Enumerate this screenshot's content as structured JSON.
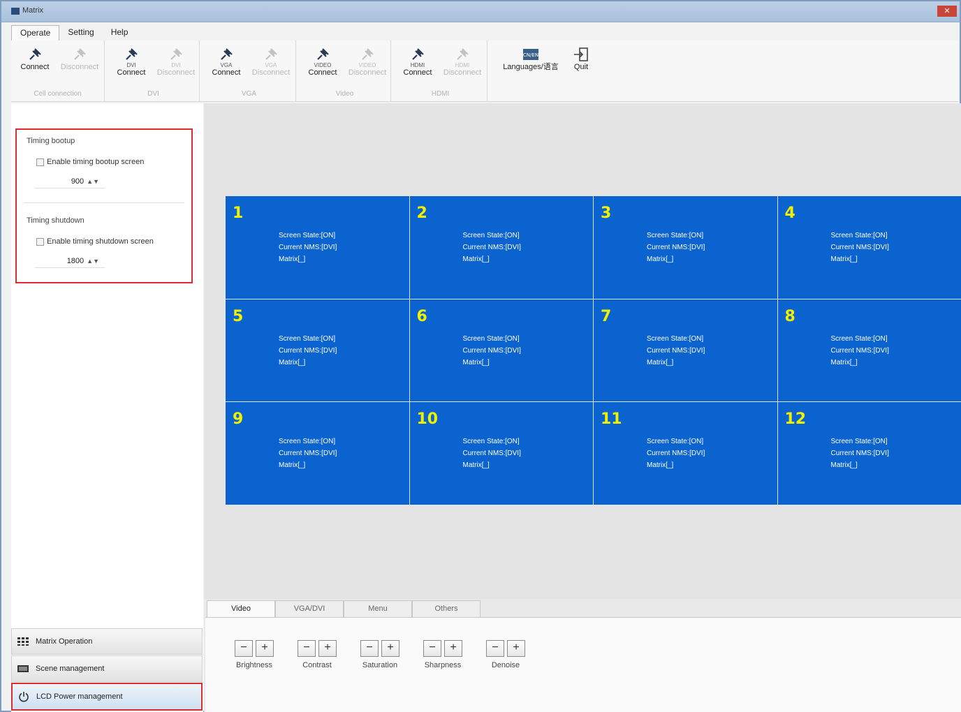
{
  "window": {
    "title": "Matrix"
  },
  "menu": [
    "Operate",
    "Setting",
    "Help"
  ],
  "ribbon": {
    "groups": [
      {
        "title": "Cell connection",
        "buttons": [
          {
            "sub": "",
            "label": "Connect",
            "enabled": true
          },
          {
            "sub": "",
            "label": "Disconnect",
            "enabled": false
          }
        ]
      },
      {
        "title": "DVI",
        "buttons": [
          {
            "sub": "DVI",
            "label": "Connect",
            "enabled": true
          },
          {
            "sub": "DVI",
            "label": "Disconnect",
            "enabled": false
          }
        ]
      },
      {
        "title": "VGA",
        "buttons": [
          {
            "sub": "VGA",
            "label": "Connect",
            "enabled": true
          },
          {
            "sub": "VGA",
            "label": "Disconnect",
            "enabled": false
          }
        ]
      },
      {
        "title": "Video",
        "buttons": [
          {
            "sub": "VIDEO",
            "label": "Connect",
            "enabled": true
          },
          {
            "sub": "VIDEO",
            "label": "Disconnect",
            "enabled": false
          }
        ]
      },
      {
        "title": "HDMI",
        "buttons": [
          {
            "sub": "HDMI",
            "label": "Connect",
            "enabled": true
          },
          {
            "sub": "HDMI",
            "label": "Disconnect",
            "enabled": false
          }
        ]
      }
    ],
    "languages_label": "Languages/语言",
    "quit_label": "Quit"
  },
  "left": {
    "bootup_title": "Timing bootup",
    "bootup_check": "Enable timing bootup screen",
    "bootup_value": "900",
    "shutdown_title": "Timing shutdown",
    "shutdown_check": "Enable timing shutdown screen",
    "shutdown_value": "1800",
    "nav": [
      "Matrix Operation",
      "Scene management",
      "LCD Power management"
    ]
  },
  "screens": [
    {
      "n": "1",
      "state": "Screen State:[ON]",
      "nms": "Current NMS:[DVI]",
      "matrix": "Matrix[_]"
    },
    {
      "n": "2",
      "state": "Screen State:[ON]",
      "nms": "Current NMS:[DVI]",
      "matrix": "Matrix[_]"
    },
    {
      "n": "3",
      "state": "Screen State:[ON]",
      "nms": "Current NMS:[DVI]",
      "matrix": "Matrix[_]"
    },
    {
      "n": "4",
      "state": "Screen State:[ON]",
      "nms": "Current NMS:[DVI]",
      "matrix": "Matrix[_]"
    },
    {
      "n": "5",
      "state": "Screen State:[ON]",
      "nms": "Current NMS:[DVI]",
      "matrix": "Matrix[_]"
    },
    {
      "n": "6",
      "state": "Screen State:[ON]",
      "nms": "Current NMS:[DVI]",
      "matrix": "Matrix[_]"
    },
    {
      "n": "7",
      "state": "Screen State:[ON]",
      "nms": "Current NMS:[DVI]",
      "matrix": "Matrix[_]"
    },
    {
      "n": "8",
      "state": "Screen State:[ON]",
      "nms": "Current NMS:[DVI]",
      "matrix": "Matrix[_]"
    },
    {
      "n": "9",
      "state": "Screen State:[ON]",
      "nms": "Current NMS:[DVI]",
      "matrix": "Matrix[_]"
    },
    {
      "n": "10",
      "state": "Screen State:[ON]",
      "nms": "Current NMS:[DVI]",
      "matrix": "Matrix[_]"
    },
    {
      "n": "11",
      "state": "Screen State:[ON]",
      "nms": "Current NMS:[DVI]",
      "matrix": "Matrix[_]"
    },
    {
      "n": "12",
      "state": "Screen State:[ON]",
      "nms": "Current NMS:[DVI]",
      "matrix": "Matrix[_]"
    }
  ],
  "tabs": [
    "Video",
    "VGA/DVI",
    "Menu",
    "Others"
  ],
  "controls": [
    "Brightness",
    "Contrast",
    "Saturation",
    "Sharpness",
    "Denoise"
  ],
  "colors": {
    "screen_bg": "#0b63cf",
    "screen_number": "#f0f000",
    "highlight": "#d92e2e"
  }
}
